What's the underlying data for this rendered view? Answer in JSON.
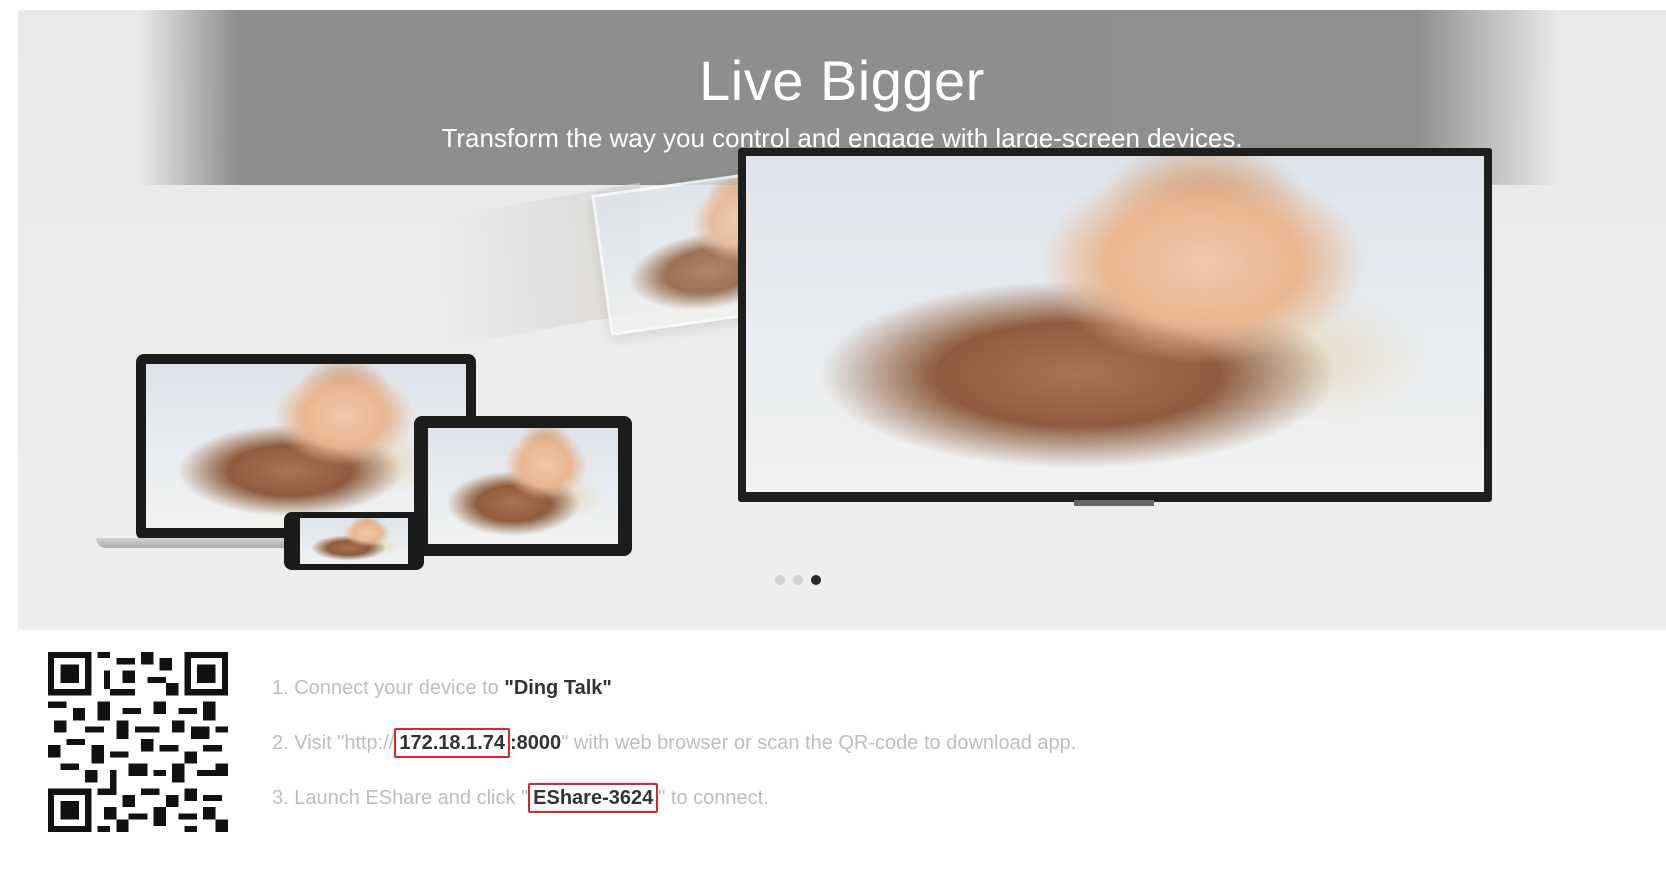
{
  "hero": {
    "title": "Live Bigger",
    "subtitle": "Transform the way you control and engage with large-screen devices.",
    "carousel": {
      "count": 3,
      "active_index": 2
    }
  },
  "instructions": {
    "step1": {
      "prefix": "1. Connect your device to ",
      "network": "\"Ding Talk\""
    },
    "step2": {
      "prefix": "2. Visit \"http://",
      "ip": "172.18.1.74",
      "port": ":8000",
      "suffix": "\" with web browser or scan the QR-code to download app."
    },
    "step3": {
      "prefix": "3. Launch EShare and click \"",
      "device": "EShare-3624",
      "suffix": "\" to connect."
    }
  },
  "colors": {
    "highlight_border": "#e0242b",
    "banner": "#8f8f8f",
    "muted_text": "#bdbdbd"
  },
  "icons": {
    "qr": "qr-code-icon"
  }
}
